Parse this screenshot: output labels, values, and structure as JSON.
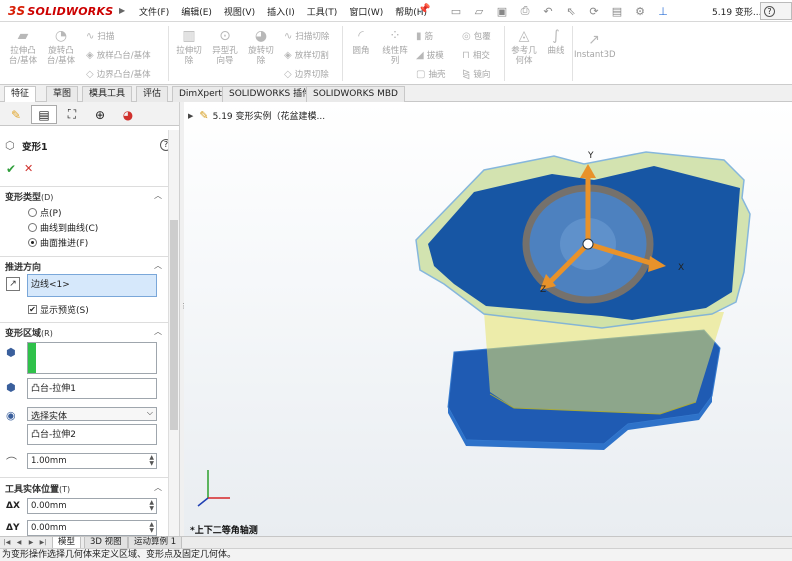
{
  "app": {
    "brand_prefix": "3S",
    "brand_name": "SOLIDWORKS",
    "doc_title": "5.19 变形...",
    "help_label": "?"
  },
  "menu": [
    "文件(F)",
    "编辑(E)",
    "视图(V)",
    "插入(I)",
    "工具(T)",
    "窗口(W)",
    "帮助(H)"
  ],
  "ribbon": {
    "extrude_boss": "拉伸凸\n台/基体",
    "revolve_boss": "旋转凸\n台/基体",
    "sweep": "扫描",
    "loft": "放样凸台/基体",
    "boundary": "边界凸台/基体",
    "extrude_cut": "拉伸切\n除",
    "hole_wizard": "异型孔\n向导",
    "revolve_cut": "旋转切\n除",
    "swept_cut": "扫描切除",
    "lofted_cut": "放样切割",
    "boundary_cut": "边界切除",
    "fillet": "圆角",
    "linear_pattern": "线性阵\n列",
    "rib": "筋",
    "draft": "拔模",
    "shell": "抽壳",
    "wrap": "包覆",
    "intersect": "相交",
    "mirror": "镜向",
    "ref_geometry": "参考几\n何体",
    "curves": "曲线",
    "instant3d": "Instant3D"
  },
  "tabs": [
    "特征",
    "草图",
    "模具工具",
    "评估",
    "DimXpert",
    "SOLIDWORKS 插件",
    "SOLIDWORKS MBD"
  ],
  "feature": {
    "name": "变形1",
    "ok": "✔",
    "cancel": "✕"
  },
  "sections": {
    "deform_type": {
      "title": "变形类型",
      "hint": "(D)",
      "options": [
        "点(P)",
        "曲线到曲线(C)",
        "曲面推进(F)"
      ],
      "selected": 2
    },
    "push_direction": {
      "title": "推进方向",
      "value": "边线<1>",
      "show_preview": "显示预览(S)"
    },
    "deform_region": {
      "title": "变形区域",
      "hint": "(R)",
      "region_value": "",
      "body_value": "凸台-拉伸1",
      "dropdown": "选择实体",
      "tool_body": "凸台-拉伸2",
      "distance": "1.00mm"
    },
    "tool_position": {
      "title": "工具实体位置",
      "hint": "(T)",
      "dx_label": "ΔX",
      "dx": "0.00mm",
      "dy_label": "ΔY",
      "dy": "0.00mm"
    }
  },
  "viewport": {
    "tree_item": "5.19 变形实例（花盆建模...",
    "view_name": "*上下二等角轴测",
    "axis_x": "X",
    "axis_y": "Y",
    "axis_z": "Z"
  },
  "bottom_tabs": [
    "模型",
    "3D 视图",
    "运动算例 1"
  ],
  "status": "为变形操作选择几何体来定义区域、变形点及固定几何体。",
  "colors": {
    "brand": "#d81e05",
    "ok": "#2f9e3b",
    "cancel": "#d0312d",
    "body_blue": "#1f4fa8",
    "body_yellow": "#e8e46a",
    "manip_orange": "#e8922a"
  }
}
